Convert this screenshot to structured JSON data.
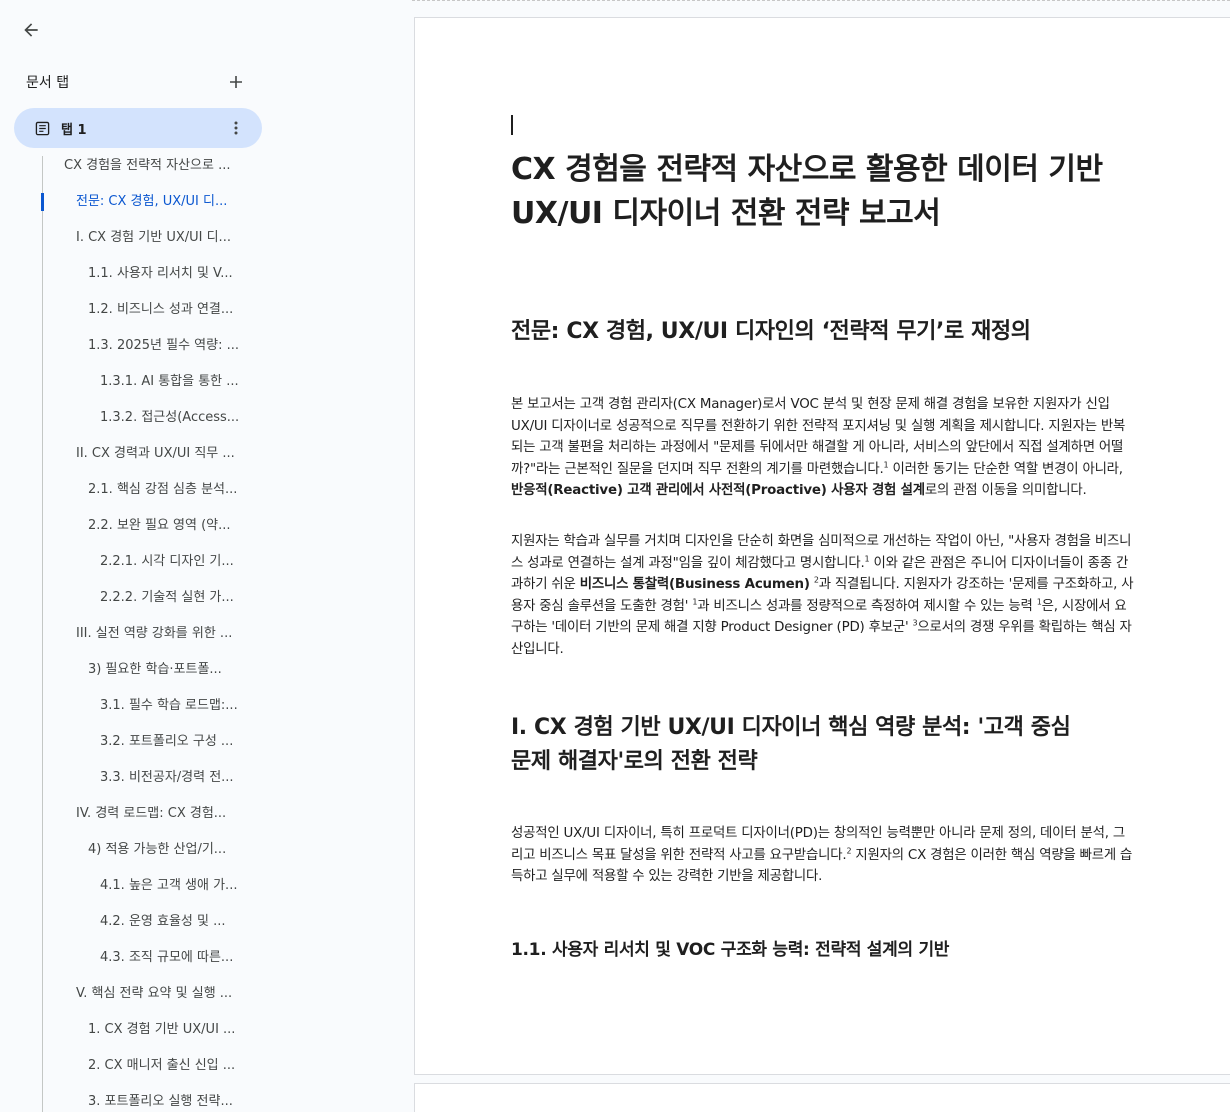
{
  "sidebar": {
    "tabs_title": "문서 탭",
    "tab": {
      "label": "탭 1"
    },
    "outline": [
      {
        "text": "CX 경험을 전략적 자산으로 ...",
        "level": 1,
        "active": false
      },
      {
        "text": "전문: CX 경험, UX/UI 디...",
        "level": 1,
        "active": true
      },
      {
        "text": "I. CX 경험 기반 UX/UI 디...",
        "level": 2,
        "active": false
      },
      {
        "text": "1.1. 사용자 리서치 및 V...",
        "level": 3,
        "active": false
      },
      {
        "text": "1.2. 비즈니스 성과 연결...",
        "level": 3,
        "active": false
      },
      {
        "text": "1.3. 2025년 필수 역량: ...",
        "level": 3,
        "active": false
      },
      {
        "text": "1.3.1. AI 통합을 통한 ...",
        "level": 4,
        "active": false
      },
      {
        "text": "1.3.2. 접근성(Access...",
        "level": 4,
        "active": false
      },
      {
        "text": "II. CX 경력과 UX/UI 직무 ...",
        "level": 2,
        "active": false
      },
      {
        "text": "2.1. 핵심 강점 심층 분석...",
        "level": 3,
        "active": false
      },
      {
        "text": "2.2. 보완 필요 영역 (약...",
        "level": 3,
        "active": false
      },
      {
        "text": "2.2.1. 시각 디자인 기...",
        "level": 4,
        "active": false
      },
      {
        "text": "2.2.2. 기술적 실현 가...",
        "level": 4,
        "active": false
      },
      {
        "text": "III. 실전 역량 강화를 위한 ...",
        "level": 2,
        "active": false
      },
      {
        "text": "3) 필요한 학습·포트폴...",
        "level": 3,
        "active": false
      },
      {
        "text": "3.1. 필수 학습 로드맵:...",
        "level": 4,
        "active": false
      },
      {
        "text": "3.2. 포트폴리오 구성 ...",
        "level": 4,
        "active": false
      },
      {
        "text": "3.3. 비전공자/경력 전...",
        "level": 4,
        "active": false
      },
      {
        "text": "IV. 경력 로드맵: CX 경험...",
        "level": 2,
        "active": false
      },
      {
        "text": "4) 적용 가능한 산업/기...",
        "level": 3,
        "active": false
      },
      {
        "text": "4.1. 높은 고객 생애 가...",
        "level": 4,
        "active": false
      },
      {
        "text": "4.2. 운영 효율성 및 ...",
        "level": 4,
        "active": false
      },
      {
        "text": "4.3. 조직 규모에 따른...",
        "level": 4,
        "active": false
      },
      {
        "text": "V. 핵심 전략 요약 및 실행 ...",
        "level": 2,
        "active": false
      },
      {
        "text": "1. CX 경험 기반 UX/UI ...",
        "level": 3,
        "active": false
      },
      {
        "text": "2. CX 매니저 출신 신입 ...",
        "level": 3,
        "active": false
      },
      {
        "text": "3. 포트폴리오 실행 전략...",
        "level": 3,
        "active": false
      }
    ]
  },
  "document": {
    "title_line1": "CX 경험을 전략적 자산으로 활용한 데이터 기반",
    "title_line2": "UX/UI 디자이너 전환 전략 보고서",
    "preface_heading": "전문: CX 경험, UX/UI 디자인의 ‘전략적 무기’로 재정의",
    "p1": {
      "a": "본 보고서는 고객 경험 관리자(CX Manager)로서 VOC 분석 및 현장 문제 해결 경험을 보유한 지원자가 신입 UX/UI 디자이너로 성공적으로 직무를 전환하기 위한 전략적 포지셔닝 및 실행 계획을 제시합니다. 지원자는 반복되는 고객 불편을 처리하는 과정에서 \"문제를 뒤에서만 해결할 게 아니라, 서비스의 앞단에서 직접 설계하면 어떨까?\"라는 근본적인 질문을 던지며 직무 전환의 계기를 마련했습니다.",
      "sup1": "1",
      "b": " 이러한 동기는 단순한 역할 변경이 아니라, ",
      "bold": "반응적(Reactive) 고객 관리에서 사전적(Proactive) 사용자 경험 설계",
      "c": "로의 관점 이동을 의미합니다."
    },
    "p2": {
      "a": "지원자는 학습과 실무를 거치며 디자인을 단순히 화면을 심미적으로 개선하는 작업이 아닌, \"사용자 경험을 비즈니스 성과로 연결하는 설계 과정\"임을 깊이 체감했다고 명시합니다.",
      "sup1": "1",
      "b": " 이와 같은 관점은 주니어 디자이너들이 종종 간과하기 쉬운 ",
      "bold": "비즈니스 통찰력(Business Acumen)",
      "c": " ",
      "sup2": "2",
      "d": "과 직결됩니다. 지원자가 강조하는 '문제를 구조화하고, 사용자 중심 솔루션을 도출한 경험' ",
      "sup3": "1",
      "e": "과 비즈니스 성과를 정량적으로 측정하여 제시할 수 있는 능력 ",
      "sup4": "1",
      "f": "은, 시장에서 요구하는 '데이터 기반의 문제 해결 지향 Product Designer (PD) 후보군' ",
      "sup5": "3",
      "g": "으로서의 경쟁 우위를 확립하는 핵심 자산입니다."
    },
    "section1_heading_line1": "I. CX 경험 기반 UX/UI 디자이너 핵심 역량 분석: '고객 중심",
    "section1_heading_line2": "문제 해결자'로의 전환 전략",
    "p3": {
      "a": "성공적인 UX/UI 디자이너, 특히 프로덕트 디자이너(PD)는 창의적인 능력뿐만 아니라 문제 정의, 데이터 분석, 그리고 비즈니스 목표 달성을 위한 전략적 사고를 요구받습니다.",
      "sup1": "2",
      "b": " 지원자의 CX 경험은 이러한 핵심 역량을 빠르게 습득하고 실무에 적용할 수 있는 강력한 기반을 제공합니다."
    },
    "sub11_heading": "1.1. 사용자 리서치 및 VOC 구조화 능력: 전략적 설계의 기반"
  }
}
